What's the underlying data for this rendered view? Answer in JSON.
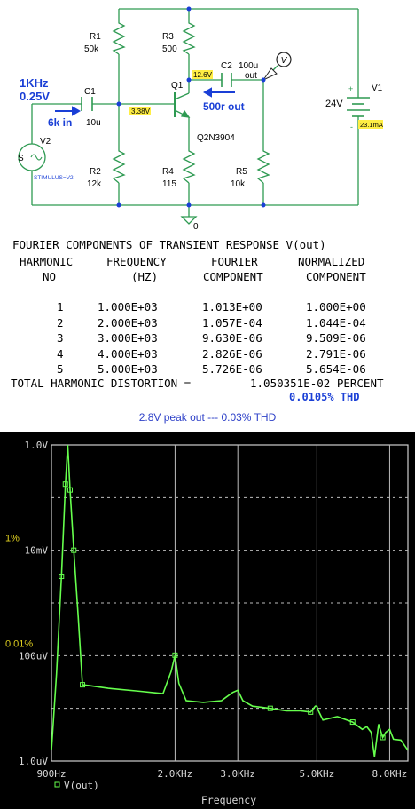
{
  "schematic": {
    "source": {
      "freq": "1KHz",
      "amp": "0.25V",
      "name": "V2",
      "symbol": "S",
      "stim": "STIMULUS=V2"
    },
    "input_note": "6k in",
    "output_note": "500r out",
    "c1": {
      "name": "C1",
      "value": "10u"
    },
    "c2": {
      "name": "C2",
      "value": "100u"
    },
    "out_label": "out",
    "r1": {
      "name": "R1",
      "value": "50k"
    },
    "r2": {
      "name": "R2",
      "value": "12k"
    },
    "r3": {
      "name": "R3",
      "value": "500"
    },
    "r4": {
      "name": "R4",
      "value": "115"
    },
    "r5": {
      "name": "R5",
      "value": "10k"
    },
    "q1": {
      "name": "Q1",
      "part": "Q2N3904"
    },
    "v1": {
      "name": "V1",
      "value": "24V",
      "plus": "+",
      "minus": "-",
      "current": "23.1mA"
    },
    "node_base": "3.38V",
    "node_collector": "12.6V",
    "probe": "V",
    "ground": "0"
  },
  "fourier": {
    "title": "FOURIER COMPONENTS OF TRANSIENT RESPONSE V(out)",
    "headers": [
      "HARMONIC",
      "FREQUENCY",
      "FOURIER",
      "NORMALIZED"
    ],
    "headers2": [
      "NO",
      "(HZ)",
      "COMPONENT",
      "COMPONENT"
    ],
    "rows": [
      [
        "1",
        "1.000E+03",
        "1.013E+00",
        "1.000E+00"
      ],
      [
        "2",
        "2.000E+03",
        "1.057E-04",
        "1.044E-04"
      ],
      [
        "3",
        "3.000E+03",
        "9.630E-06",
        "9.509E-06"
      ],
      [
        "4",
        "4.000E+03",
        "2.826E-06",
        "2.791E-06"
      ],
      [
        "5",
        "5.000E+03",
        "5.726E-06",
        "5.654E-06"
      ]
    ],
    "thd_label": "TOTAL HARMONIC DISTORTION =",
    "thd_value": "1.050351E-02 PERCENT",
    "thd_pct": "0.0105% THD"
  },
  "note": "2.8V peak out --- 0.03% THD",
  "colors": {
    "trace": "#66ff4d",
    "grid": "#bdbdbd",
    "plot_bg": "#000000",
    "annot": "#e0d020",
    "blue": "#1a3fd6",
    "highlight": "#ffee44"
  },
  "chart_data": {
    "type": "line",
    "xscale": "log",
    "yscale": "log",
    "xlim": [
      900,
      9000
    ],
    "ylim": [
      1e-06,
      1.0
    ],
    "xlabel": "Frequency",
    "ylabel": "",
    "grid": true,
    "legend": "bottom-left",
    "xticks": [
      900,
      2000,
      3000,
      5000,
      8000
    ],
    "xtick_labels": [
      "900Hz",
      "2.0KHz",
      "3.0KHz",
      "5.0KHz",
      "8.0KHz"
    ],
    "yticks": [
      1.0,
      0.01,
      0.0001,
      1e-06
    ],
    "ytick_labels": [
      "1.0V",
      "10mV",
      "100uV",
      "1.0uV"
    ],
    "annotations": [
      {
        "text": "1%",
        "y": 0.01
      },
      {
        "text": "0.01%",
        "y": 0.0001
      }
    ],
    "series": [
      {
        "name": "V(out)",
        "x": [
          900,
          930,
          960,
          985,
          1000,
          1015,
          1040,
          1070,
          1100,
          1150,
          1300,
          1600,
          1850,
          1950,
          2000,
          2050,
          2150,
          2400,
          2700,
          2900,
          3000,
          3100,
          3300,
          3700,
          4100,
          4500,
          4800,
          4950,
          5000,
          5050,
          5200,
          5700,
          6300,
          6700,
          6900,
          7100,
          7250,
          7450,
          7650,
          7800,
          8000,
          8200,
          8600,
          9000
        ],
        "y": [
          1.6e-06,
          4.5e-05,
          0.0032,
          0.18,
          1.0,
          0.14,
          0.01,
          0.00055,
          2.8e-05,
          2.7e-05,
          2.4e-05,
          2.1e-05,
          1.9e-05,
          5e-05,
          0.000102,
          3e-05,
          1.4e-05,
          1.3e-05,
          1.4e-05,
          2e-05,
          2.2e-05,
          1.4e-05,
          1.1e-05,
          1e-05,
          9e-06,
          9e-06,
          8.5e-06,
          1.1e-05,
          1.1e-05,
          9e-06,
          6e-06,
          7e-06,
          5.5e-06,
          4e-06,
          4.5e-06,
          3.5e-06,
          1.2e-06,
          5e-06,
          2.8e-06,
          3.5e-06,
          4e-06,
          2.6e-06,
          2.5e-06,
          1.6e-06
        ]
      }
    ]
  },
  "legend_label": "V(out)"
}
